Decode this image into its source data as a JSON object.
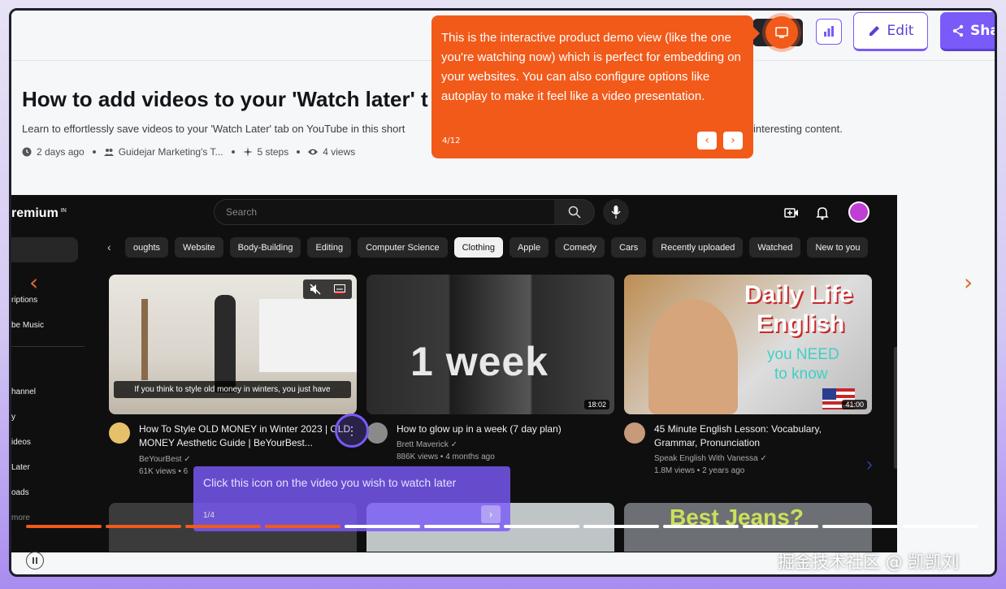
{
  "header": {
    "edit_label": "Edit",
    "share_label": "Sha",
    "icons": [
      "monitor-icon",
      "analytics-icon",
      "pencil-icon",
      "share-icon"
    ]
  },
  "demo": {
    "title": "How to add videos to your 'Watch later' t",
    "description": "Learn to effortlessly save videos to your 'Watch Later' tab on YouTube in this short",
    "description_end": "interesting content.",
    "meta": {
      "age": "2 days ago",
      "team": "Guidejar Marketing's T...",
      "steps": "5 steps",
      "views": "4 views"
    }
  },
  "tooltip": {
    "text": "This is the interactive product demo view (like the one you're watching now) which is perfect for embedding on your websites. You can also configure options like autoplay to make it feel like a video presentation.",
    "step": "4/12",
    "prev": "‹",
    "next": "›"
  },
  "youtube": {
    "logo": "remium",
    "logo_badge": "IN",
    "search_placeholder": "Search",
    "sidebar": [
      "riptions",
      "be Music",
      "hannel",
      "y",
      "ideos",
      "Later",
      "oads",
      "more"
    ],
    "chips": [
      "oughts",
      "Website",
      "Body-Building",
      "Editing",
      "Computer Science",
      "Clothing",
      "Apple",
      "Comedy",
      "Cars",
      "Recently uploaded",
      "Watched",
      "New to you"
    ],
    "selected_chip": "Clothing",
    "videos": [
      {
        "title": "How To Style OLD MONEY in Winter 2023 | OLD MONEY Aesthetic Guide | BeYourBest...",
        "channel": "BeYourBest ✓",
        "stats": "61K views • 6",
        "caption": "If you think to style old money in winters, you just have"
      },
      {
        "title": "How to glow up in a week (7 day plan)",
        "channel": "Brett Maverick ✓",
        "stats": "886K views • 4 months ago",
        "overlay": "1 week",
        "duration": "18:02"
      },
      {
        "title": "45 Minute English Lesson: Vocabulary, Grammar, Pronunciation",
        "channel": "Speak English With Vanessa ✓",
        "stats": "1.8M views • 2 years ago",
        "overlay1": "Daily Life",
        "overlay2": "English",
        "overlay3": "you NEED",
        "overlay4": "to know",
        "duration": "41:00"
      }
    ],
    "row2_overlay": "Best Jeans?"
  },
  "pointer_tip": {
    "text": "Click this icon on the video you wish to watch later",
    "step": "1/4",
    "next": "›"
  },
  "progress": {
    "total": 12,
    "completed": 4
  },
  "nav": {
    "prev": "‹",
    "next": "›"
  },
  "watermark": "掘金技术社区 @ 凯凯刘",
  "colors": {
    "accent": "#f25a1a",
    "brand": "#7a5af8"
  }
}
